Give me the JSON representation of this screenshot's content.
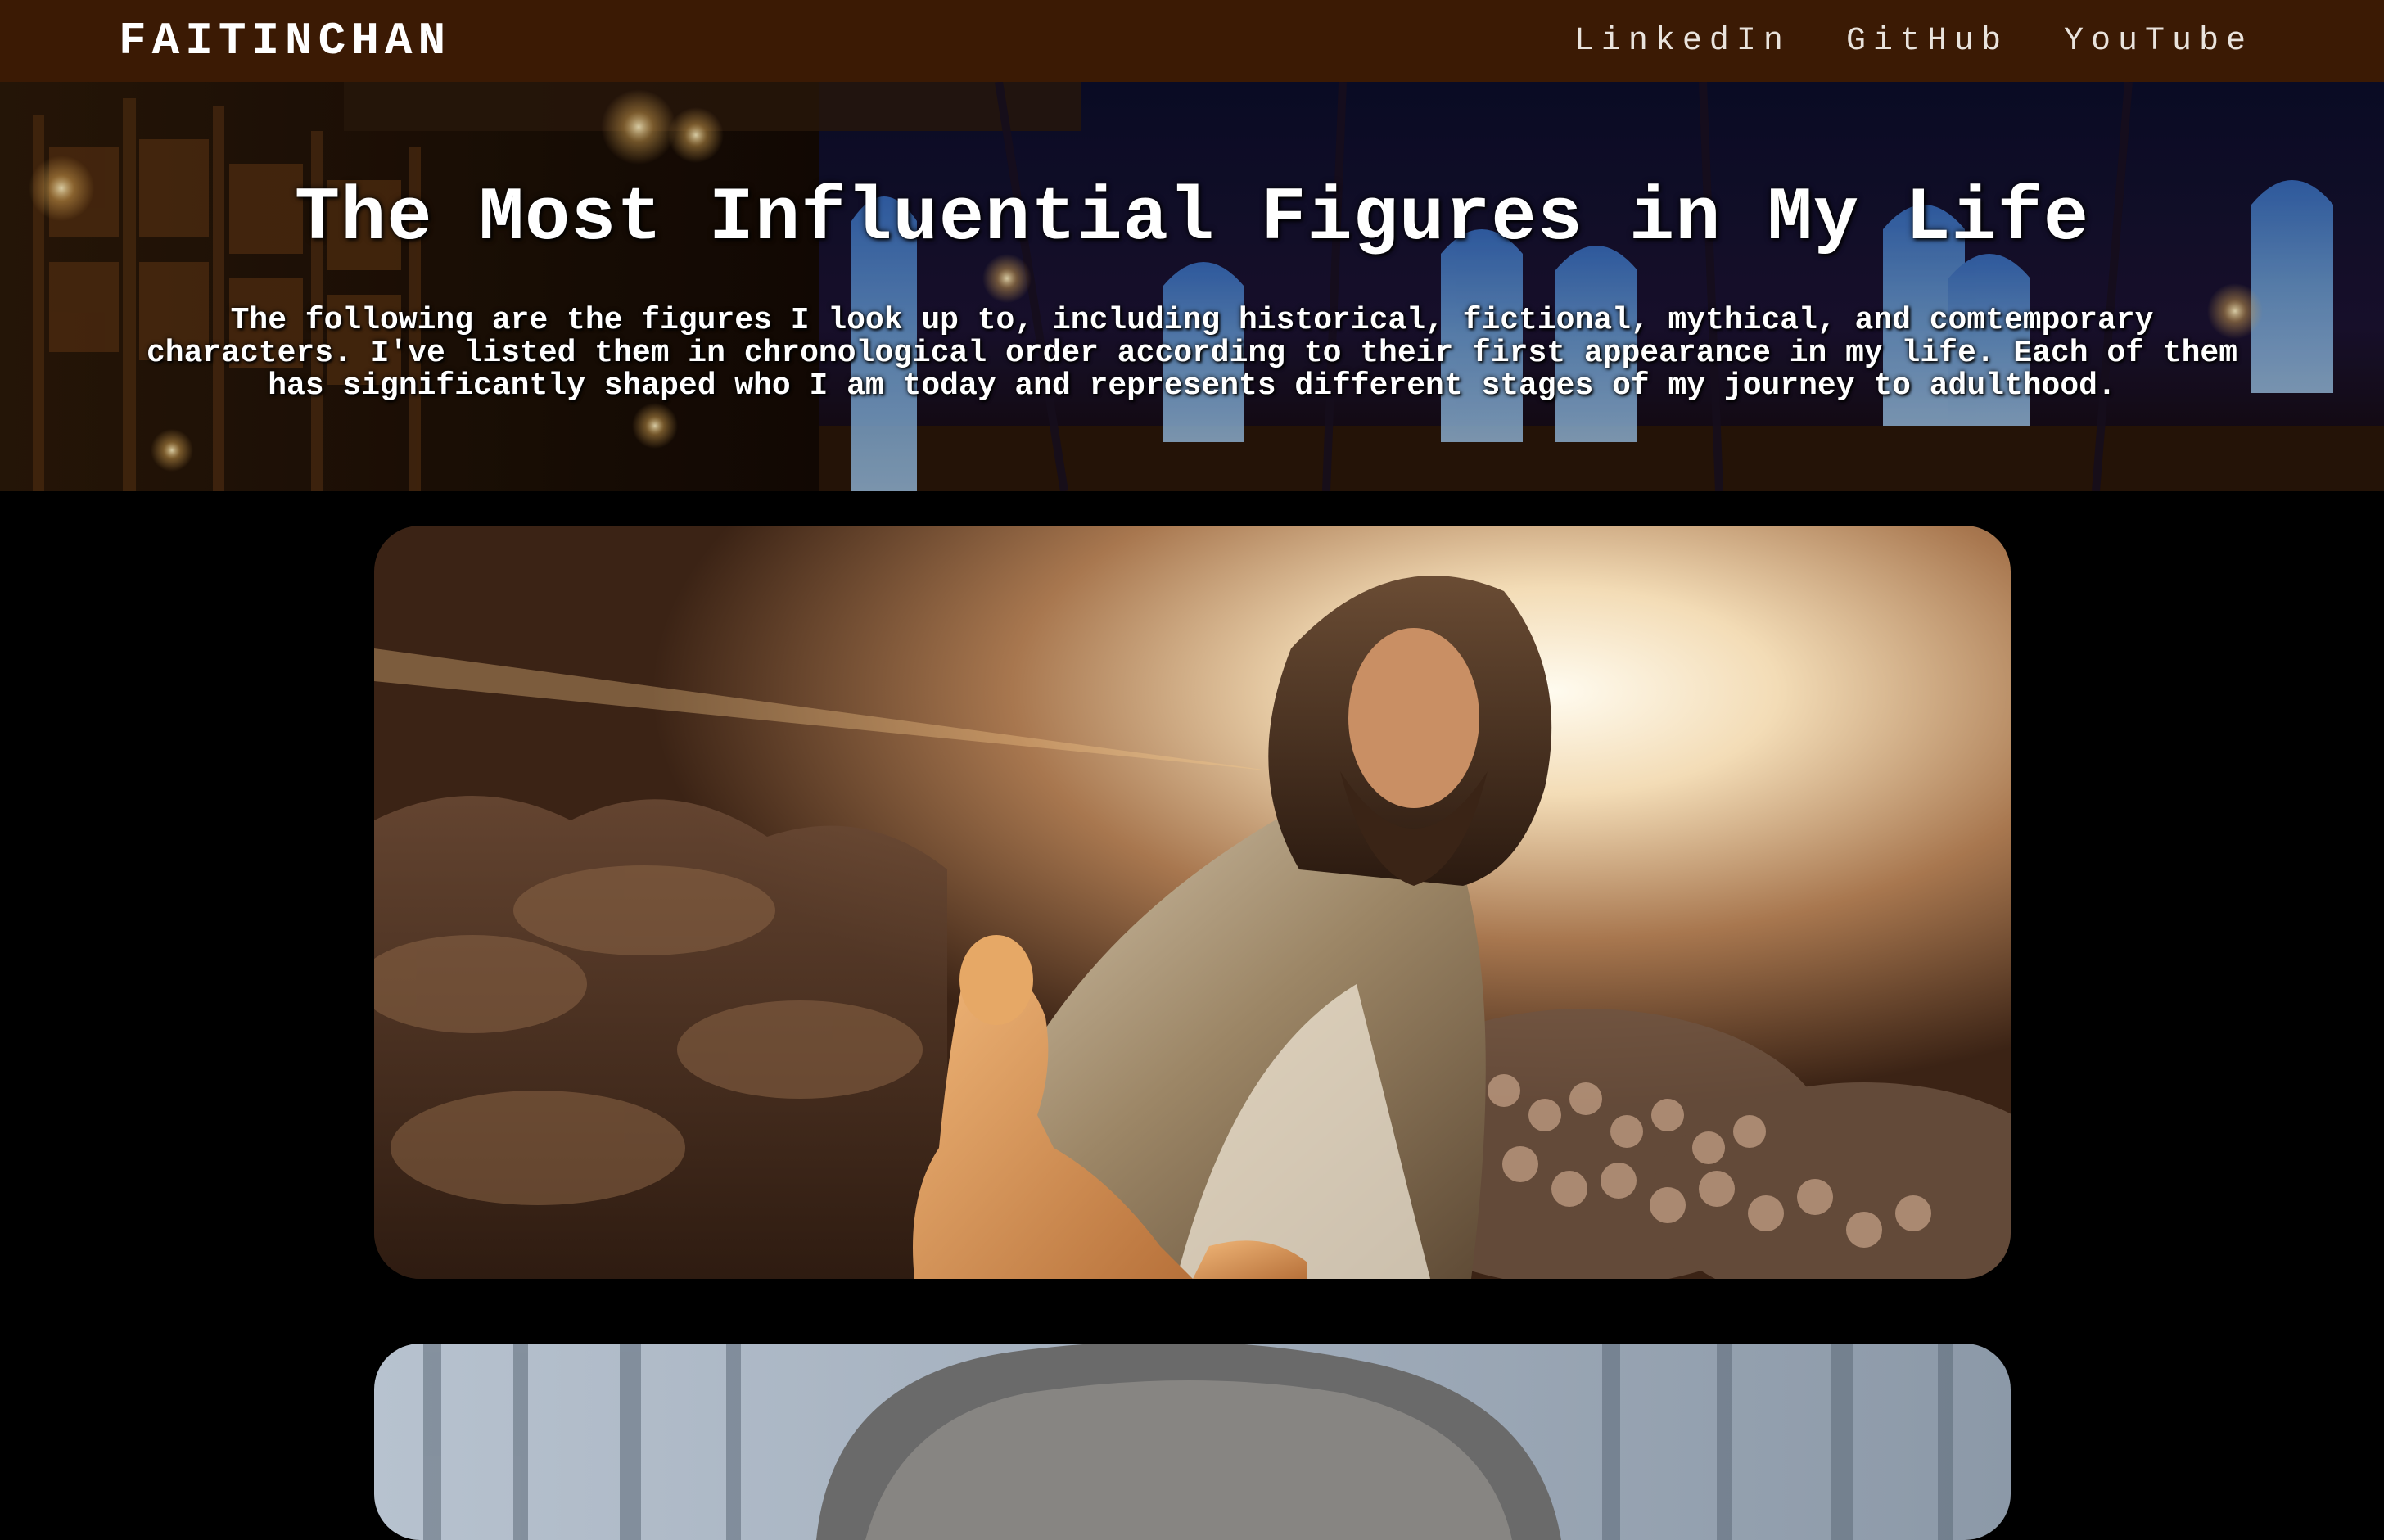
{
  "navbar": {
    "brand": "FAITINCHAN",
    "links": [
      "LinkedIn",
      "GitHub",
      "YouTube"
    ]
  },
  "hero": {
    "title": "The Most Influential Figures in My Life",
    "description": "The following are the figures I look up to, including historical, fictional, mythical, and comtemporary characters. I've listed them in chronological order according to their first appearance in my life. Each of them has significantly shaped who I am today and represents different stages of my journey to adulthood."
  },
  "figures": [
    {
      "image": "jesus-painting"
    },
    {
      "image": "grey-haired-portrait"
    }
  ],
  "colors": {
    "navbar_bg": "#3b1a04",
    "page_bg": "#000000",
    "text": "#ffffff"
  }
}
